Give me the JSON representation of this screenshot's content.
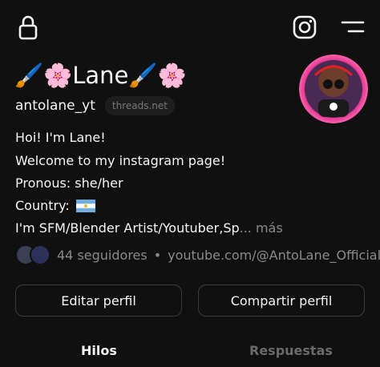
{
  "profile": {
    "display_name": "🖌️🌸Lane🖌️🌸",
    "username": "antolane_yt",
    "threads_badge": "threads.net",
    "bio_lines": [
      "Hoi! I'm Lane!",
      "Welcome to my instagram page!",
      "Pronous: she/her",
      "Country:",
      "I'm SFM/Blender Artist/Youtuber,Sp"
    ],
    "bio_more": "... más",
    "followers": "44 seguidores",
    "separator": "•",
    "link": "youtube.com/@AntoLane_Official"
  },
  "actions": {
    "edit": "Editar perfil",
    "share": "Compartir perfil"
  },
  "tabs": [
    {
      "label": "Hilos",
      "active": true
    },
    {
      "label": "Respuestas",
      "active": false
    }
  ],
  "icons": {
    "top_left": "lock-icon",
    "top_right_1": "instagram-icon",
    "top_right_2": "menu-icon",
    "country_flag": "argentina-flag-icon"
  },
  "colors": {
    "background": "#101010",
    "text": "#f3f5f7",
    "muted": "#8a8a8a",
    "border": "#3a3a3a"
  }
}
